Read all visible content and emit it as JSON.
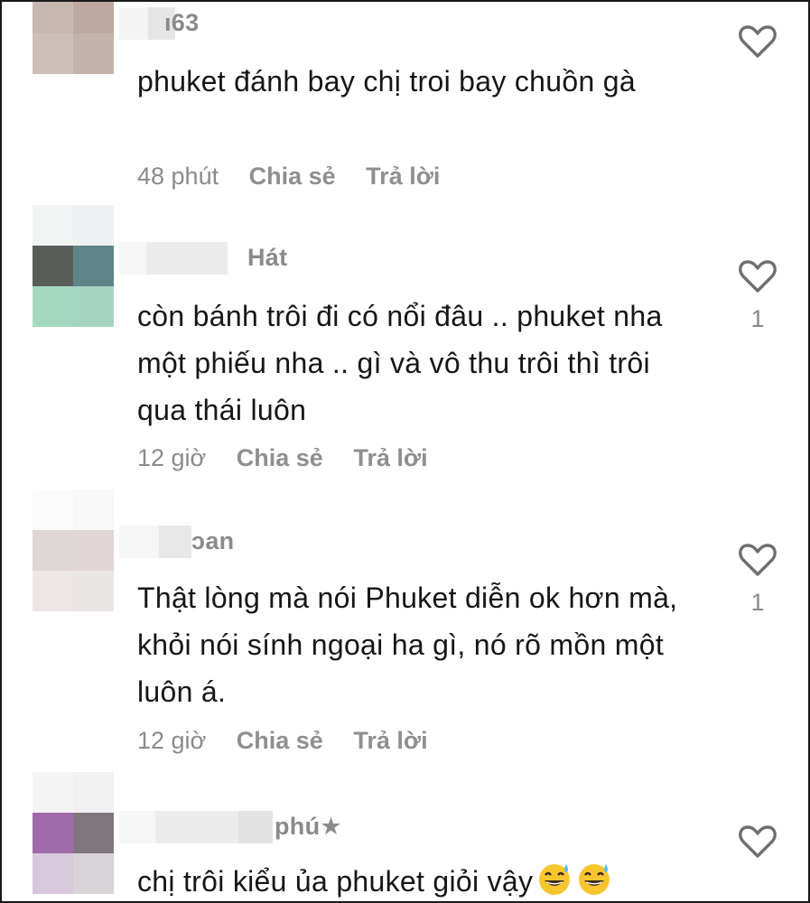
{
  "comments": [
    {
      "username": "ı63",
      "text": "phuket đánh bay chị troi bay chuồn gà",
      "time": "48 phút",
      "share_label": "Chia sẻ",
      "reply_label": "Trả lời",
      "likes": "",
      "like_icon": "heart-outline-icon"
    },
    {
      "username": "Hát",
      "text": "còn bánh trôi đi có nổi đâu .. phuket nha một phiếu nha .. gì và vô thu trôi thì trôi qua thái luôn",
      "time": "12 giờ",
      "share_label": "Chia sẻ",
      "reply_label": "Trả lời",
      "likes": "1",
      "like_icon": "heart-outline-icon"
    },
    {
      "username": "ɔan",
      "text": "Thật lòng mà nói Phuket diễn ok hơn mà, khỏi nói sính ngoại ha gì, nó rõ mồn một luôn á.",
      "time": "12 giờ",
      "share_label": "Chia sẻ",
      "reply_label": "Trả lời",
      "likes": "1",
      "like_icon": "heart-outline-icon"
    },
    {
      "username": "phú★",
      "text": "chị trôi kiểu ủa phuket giỏi vậy",
      "emojis": [
        "grinning-sweat-emoji",
        "grinning-sweat-emoji"
      ],
      "like_icon": "heart-outline-icon"
    }
  ],
  "colors": {
    "text": "#161616",
    "muted": "#8a8a8a",
    "icon": "#6f6f6f",
    "border": "#1a1a1a"
  }
}
